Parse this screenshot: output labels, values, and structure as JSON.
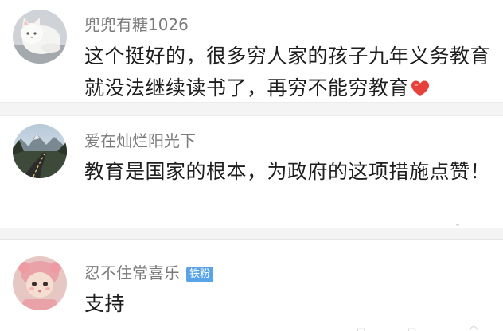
{
  "comments": [
    {
      "username": "兜兜有糖1026",
      "text": "这个挺好的，很多穷人家的孩子九年义务教育就没法继续读书了，再穷不能穷教育",
      "emoji": "red-heart"
    },
    {
      "username": "爱在灿烂阳光下",
      "text": "教育是国家的根本，为政府的这项措施点赞！"
    },
    {
      "username": "忍不住常喜乐",
      "badge": "铁粉",
      "text": "支持"
    }
  ],
  "colors": {
    "username": "#7b7b7b",
    "text": "#1e1e1e",
    "badge_bg": "#59a4e8",
    "separator": "#f4f4f4",
    "heart": "#e8403a"
  }
}
